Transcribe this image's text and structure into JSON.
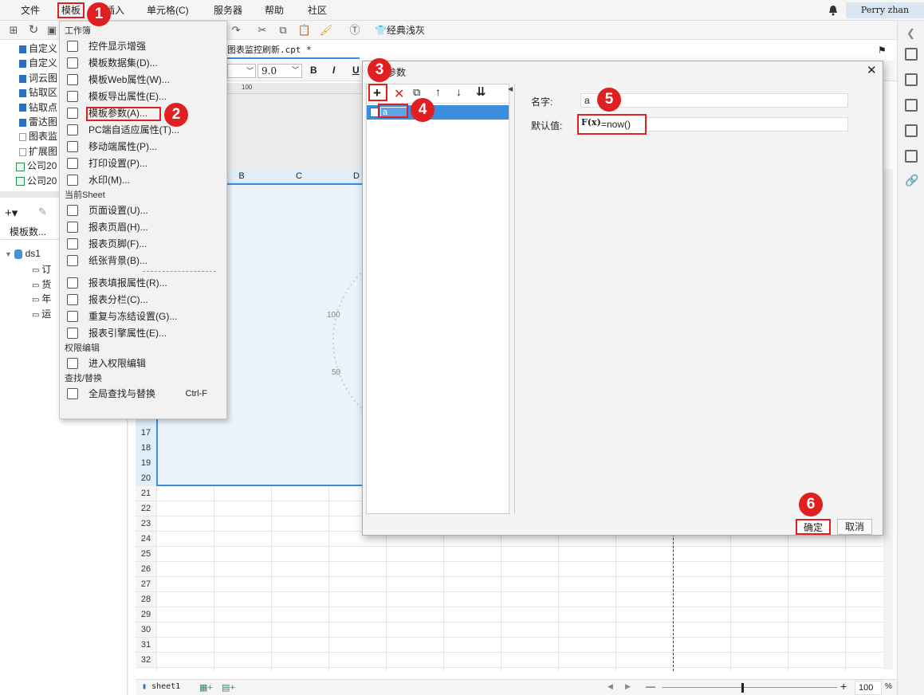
{
  "menubar": {
    "items": [
      "文件",
      "模板",
      "插入",
      "单元格(C)",
      "服务器",
      "帮助",
      "社区"
    ],
    "user": "Perry zhan"
  },
  "toolbar": {
    "theme_label": "经典浅灰"
  },
  "file_tab": "图表监控刷新.cpt *",
  "format_bar": {
    "font_size": "9.0",
    "bold": "B",
    "italic": "I",
    "underline": "U"
  },
  "ruler_mark": "100",
  "col_headers": [
    "B",
    "C",
    "D"
  ],
  "row_numbers": [
    "17",
    "18",
    "19",
    "20",
    "21",
    "22",
    "23",
    "24",
    "25",
    "26",
    "27",
    "28",
    "29",
    "30",
    "31",
    "32"
  ],
  "gauge_labels": [
    "100",
    "50"
  ],
  "tree": {
    "items": [
      {
        "label": "自定义",
        "type": "file"
      },
      {
        "label": "自定义",
        "type": "file"
      },
      {
        "label": "词云图",
        "type": "file"
      },
      {
        "label": "钻取区",
        "type": "file"
      },
      {
        "label": "钻取点",
        "type": "file"
      },
      {
        "label": "雷达图",
        "type": "file"
      },
      {
        "label": "图表监",
        "type": "doc"
      },
      {
        "label": "扩展图",
        "type": "doc"
      },
      {
        "label": "公司20",
        "type": "excel"
      },
      {
        "label": "公司20",
        "type": "excel"
      }
    ]
  },
  "dataset_panel": {
    "title": "模板数...",
    "ds_name": "ds1",
    "fields": [
      "订",
      "货",
      "年",
      "运"
    ]
  },
  "menu": {
    "section_workbook": "工作簿",
    "workbook_items": [
      "控件显示增强",
      "模板数据集(D)...",
      "模板Web属性(W)...",
      "模板导出属性(E)...",
      "模板参数(A)...",
      "PC端自适应属性(T)...",
      "移动端属性(P)...",
      "打印设置(P)...",
      "水印(M)..."
    ],
    "section_sheet": "当前Sheet",
    "sheet_items": [
      "页面设置(U)...",
      "报表页眉(H)...",
      "报表页脚(F)...",
      "纸张背景(B)..."
    ],
    "sheet_items2": [
      "报表填报属性(R)...",
      "报表分栏(C)...",
      "重复与冻结设置(G)...",
      "报表引擎属性(E)..."
    ],
    "section_perm": "权限编辑",
    "perm_items": [
      "进入权限编辑"
    ],
    "section_find": "查找/替换",
    "find_items": [
      {
        "label": "全局查找与替换",
        "shortcut": "Ctrl-F"
      }
    ]
  },
  "dialog": {
    "title": "参数",
    "param_item": "a",
    "name_label": "名字:",
    "name_value": "a",
    "default_label": "默认值:",
    "default_value": "=now()",
    "formula_icon": "F(x)",
    "ok": "确定",
    "cancel": "取消"
  },
  "badges": [
    "1",
    "2",
    "3",
    "4",
    "5",
    "6"
  ],
  "statusbar": {
    "sheet": "sheet1",
    "zoom": "100",
    "percent": "%",
    "minus": "—",
    "plus": "+"
  },
  "colors": {
    "highlight": "#e02020",
    "selection": "#3c8dde",
    "brand_blue": "#2c6fbd"
  }
}
